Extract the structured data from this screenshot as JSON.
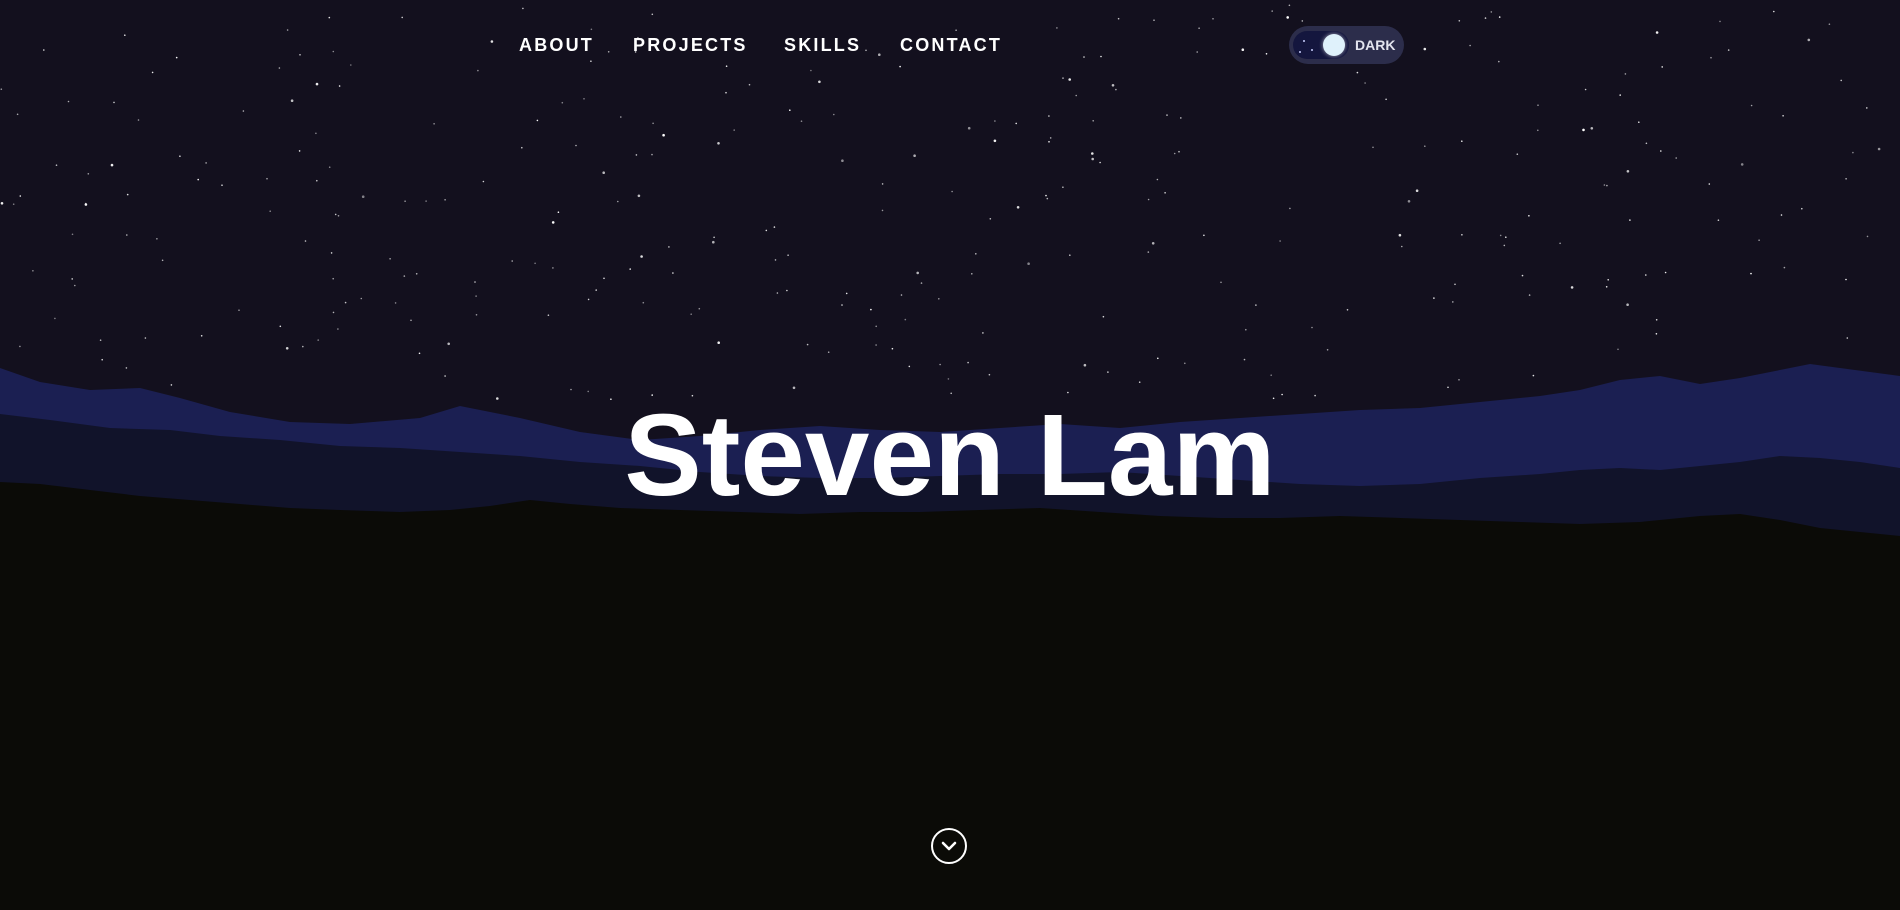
{
  "nav": {
    "items": [
      {
        "label": "ABOUT"
      },
      {
        "label": "PROJECTS"
      },
      {
        "label": "SKILLS"
      },
      {
        "label": "CONTACT"
      }
    ]
  },
  "theme_toggle": {
    "label": "DARK",
    "state": "dark",
    "knob_icon": "moon-icon"
  },
  "hero": {
    "title": "Steven Lam"
  },
  "scroll_button": {
    "icon": "chevron-down-icon"
  },
  "colors": {
    "sky": "#13101e",
    "far_mountains": "#1b1f52",
    "mid_mountains": "#11132a",
    "ground": "#0b0b07",
    "text": "#ffffff",
    "toggle_bg": "#2c2d4b",
    "toggle_track": "#14163e",
    "toggle_knob": "#dff1fb"
  }
}
